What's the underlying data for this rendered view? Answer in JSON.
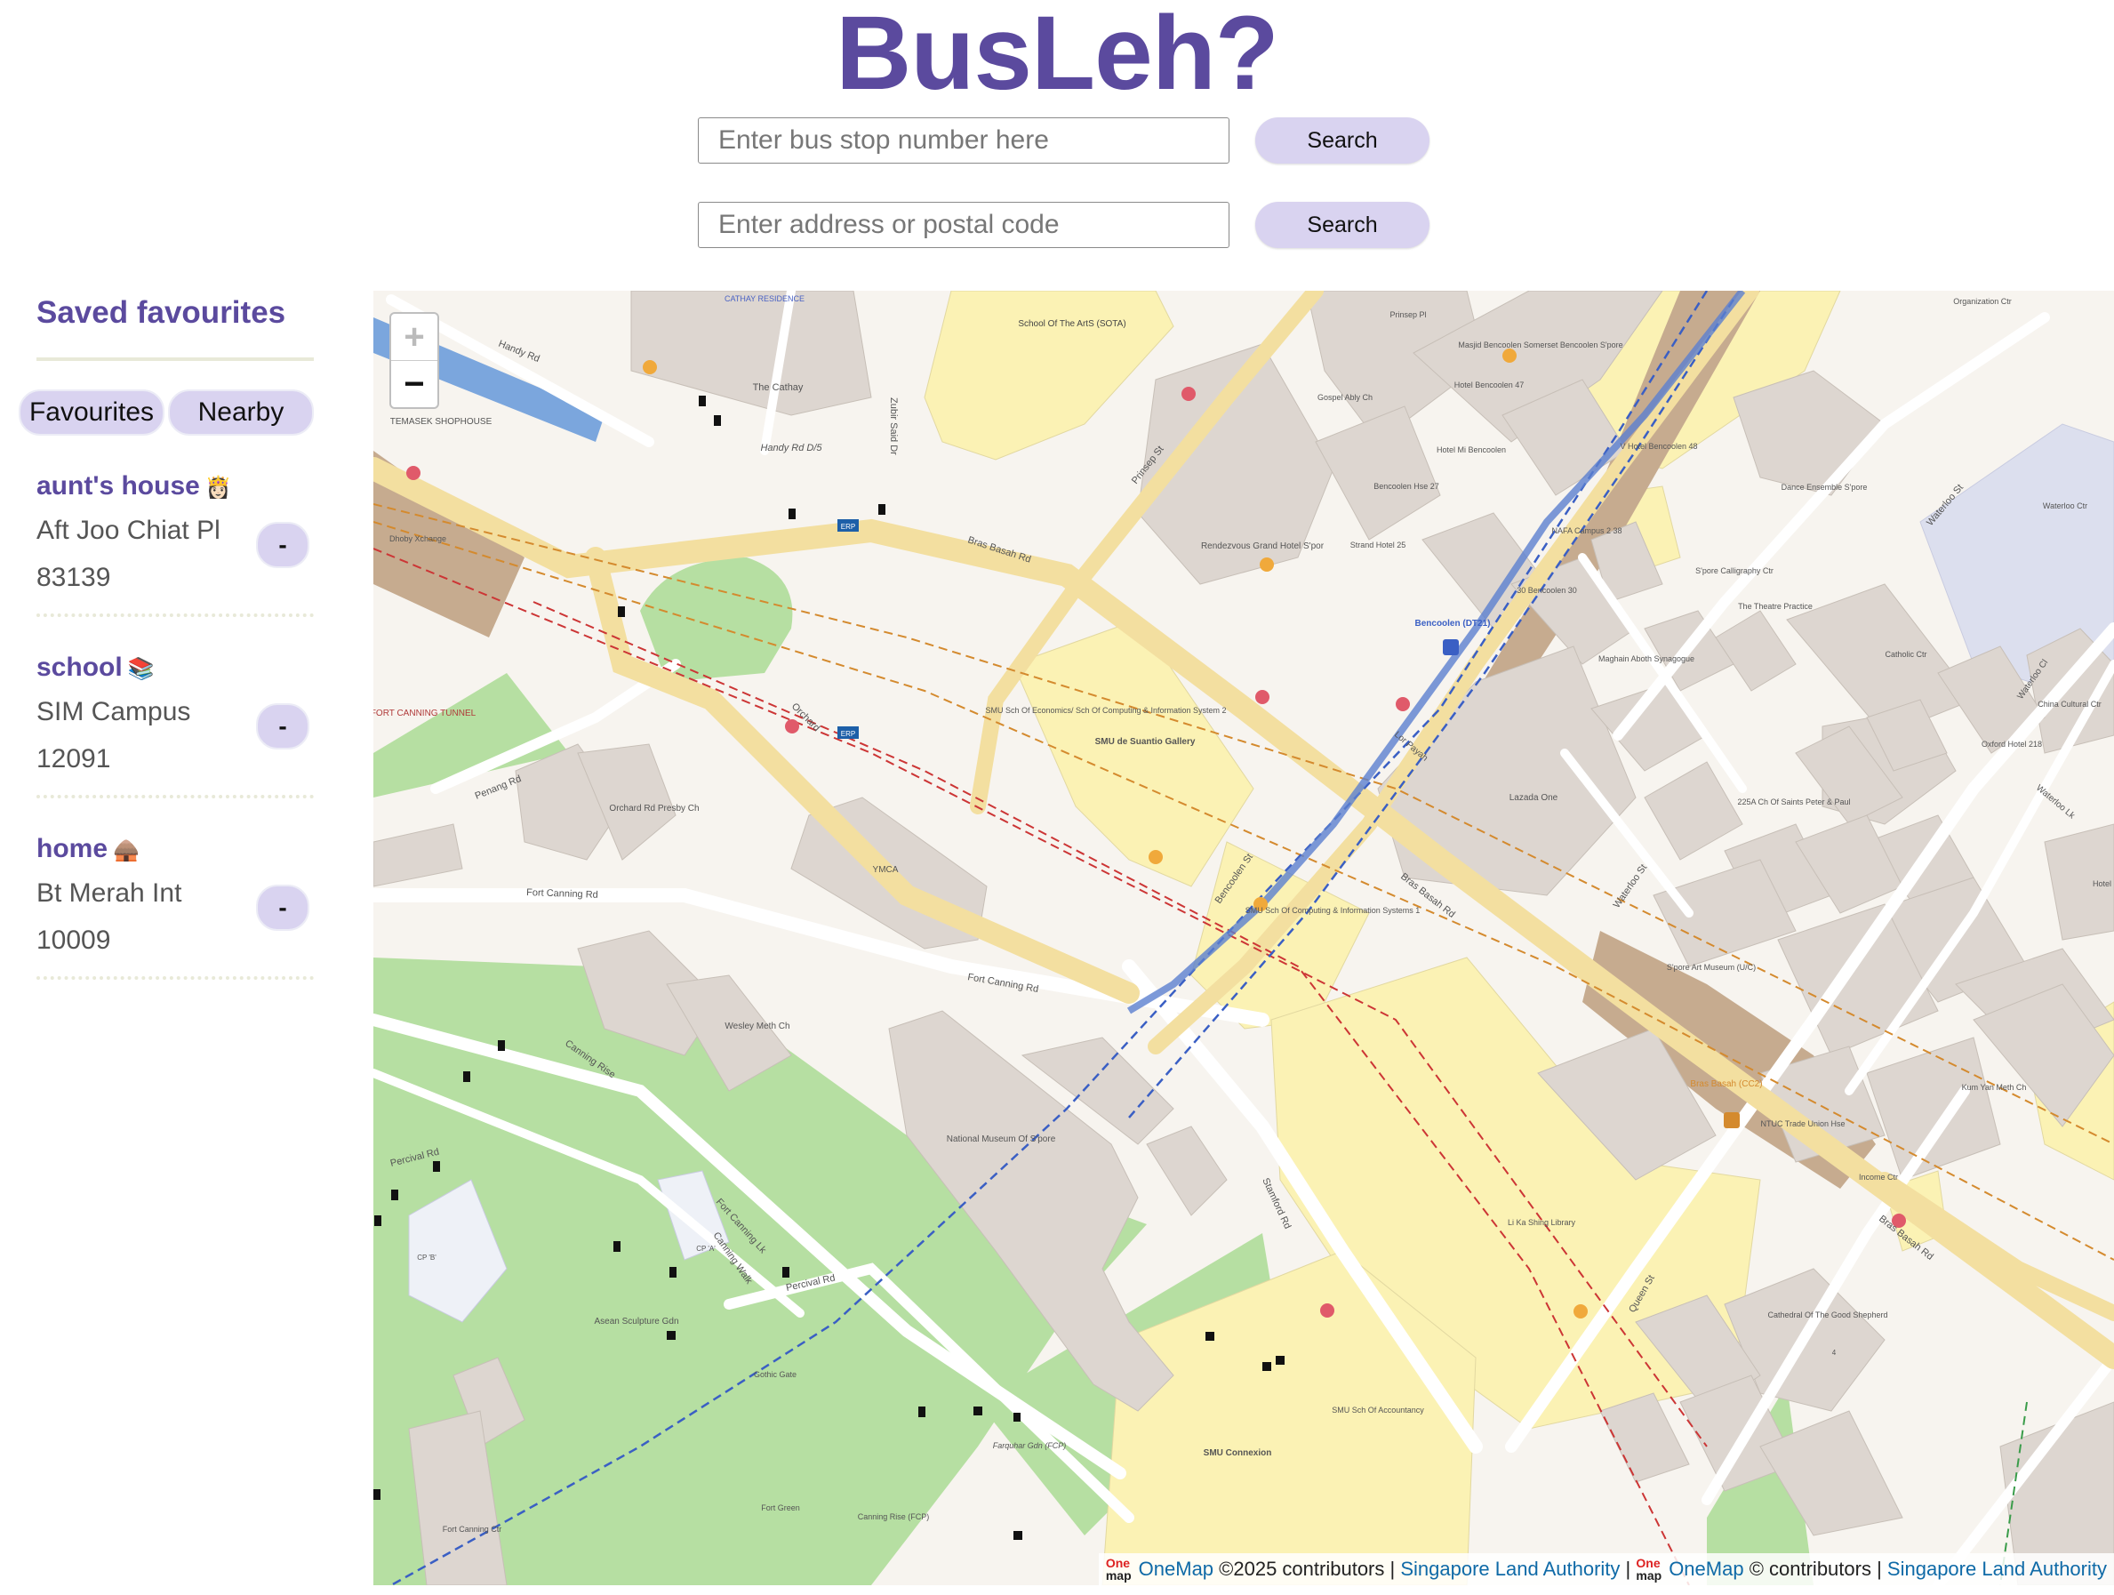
{
  "app": {
    "title": "BusLeh?"
  },
  "search": {
    "bus_stop_placeholder": "Enter bus stop number here",
    "address_placeholder": "Enter address or postal code",
    "button_label": "Search"
  },
  "sidebar": {
    "heading": "Saved favourites",
    "tabs": [
      "Favourites",
      "Nearby"
    ],
    "items": [
      {
        "name": "aunt's house",
        "emoji": "👸🏻",
        "stop_name": "Aft Joo Chiat Pl",
        "stop_code": "83139",
        "remove_label": "-"
      },
      {
        "name": "school",
        "emoji": "📚",
        "stop_name": "SIM Campus",
        "stop_code": "12091",
        "remove_label": "-"
      },
      {
        "name": "home",
        "emoji": "🛖",
        "stop_name": "Bt Merah Int",
        "stop_code": "10009",
        "remove_label": "-"
      }
    ]
  },
  "map": {
    "zoom_in": "+",
    "zoom_out": "−",
    "attribution": {
      "onemap": "OneMap",
      "copyright_2025": "©2025 contributors |",
      "sla": "Singapore Land Authority",
      "sep": "|",
      "onemap2": "OneMap",
      "copyright": "© contributors |",
      "sla2": "Singapore Land Authority",
      "logo_one": "One",
      "logo_map": "map"
    },
    "labels": {
      "handy_rd": "Handy Rd",
      "cathay": "The Cathay",
      "handy_rd_5": "Handy Rd D/5",
      "zubir": "Zubir Said Dr",
      "temasek": "TEMASEK SHOPHOUSE",
      "sota": "School Of The ArtS (SOTA)",
      "prinsep_st": "Prinsep St",
      "bras_basah_rd": "Bras Basah Rd",
      "bras_basah_rd2": "Bras Basah Rd",
      "bras_basah_rd3": "Bras Basah Rd",
      "orchard": "Orchard",
      "penang_rd": "Penang Rd",
      "fort_canning_tunnel": "FORT CANNING TUNNEL",
      "orchard_presby": "Orchard Rd Presby Ch",
      "ymca": "YMCA",
      "fort_canning_rd": "Fort Canning Rd",
      "fort_canning_rd2": "Fort Canning Rd",
      "wesley": "Wesley Meth Ch",
      "canning_rise": "Canning Rise",
      "percival_rd": "Percival Rd",
      "percival_rd2": "Percival Rd",
      "fort_canning_lk": "Fort Canning Lk",
      "canning_walk": "Canning Walk",
      "national_museum": "National Museum Of S'pore",
      "asean": "Asean Sculpture Gdn",
      "gothic": "Gothic Gate",
      "fort_green": "Fort Green",
      "canning_rise_fcp": "Canning Rise (FCP)",
      "farquhar": "Farquhar Gdn (FCP)",
      "fort_canning_ctr": "Fort Canning Ctr",
      "rendezvous": "Rendezvous Grand Hotel S'por",
      "smu_econ": "SMU Sch Of Economics/ Sch Of Computing & Information System 2",
      "smu_gallery": "SMU de Suantio Gallery",
      "smu_compute": "SMU Sch Of Computing & Information Systems 1",
      "smu_connexion": "SMU Connexion",
      "smu_accountancy": "SMU Sch Of Accountancy",
      "bencoolen_st": "Bencoolen St",
      "stamford_rd": "Stamford Rd",
      "bencoolen_stn": "Bencoolen (DT21)",
      "lazada": "Lazada One",
      "li_ka_shing": "Li Ka Shing Library",
      "bras_basah_stn": "Bras Basah (CC2)",
      "sam": "S'pore Art Museum (U/C)",
      "waterloo_st": "Waterloo St",
      "waterloo_st2": "Waterloo St",
      "queen_st": "Queen St",
      "ntuc": "NTUC Trade Union Hse",
      "income_ctr": "Income Ctr",
      "kum_yan": "Kum Yan Meth Ch",
      "cathedral": "Cathedral Of The Good Shepherd",
      "cathedral_num": "4",
      "gospel": "Gospel Ably Ch",
      "masjid": "Masjid Bencoolen Somerset Bencoolen S'pore",
      "hotel_bencoolen": "Hotel Bencoolen 47",
      "hotel_mi": "Hotel Mi Bencoolen",
      "bencoolen_hse": "Bencoolen Hse 27",
      "strand": "Strand Hotel 25",
      "nafa": "NAFA Campus 2 38",
      "v_hotel": "V Hotel Bencoolen 48",
      "dance": "Dance Ensemble S'pore",
      "calligraphy": "S'pore Calligraphy Ctr",
      "theatre": "The Theatre Practice",
      "maghain": "Maghain Aboth Synagogue",
      "bencoolen_30": "30 Bencoolen 30",
      "catholic": "Catholic Ctr",
      "oxford": "Oxford Hotel 218",
      "china_cultural": "China Cultural Ctr",
      "saints": "225A Ch Of Saints Peter & Paul",
      "waterloo_ctr": "Waterloo Ctr",
      "prinsep_pl": "Prinsep Pl",
      "lor_payah": "Lor Payah",
      "waterloo_cl": "Waterloo Cl",
      "waterloo_lk": "Waterloo Lk",
      "hotel_roy": "Hotel Roy @ Queen",
      "cathay_res": "CATHAY RESIDENCE",
      "dhoby": "Dhoby Xchange",
      "org_ctr": "Organization Ctr",
      "cp_a": "CP 'A'",
      "cp_b": "CP 'B'",
      "erp": "ERP",
      "erp2": "ERP"
    }
  }
}
